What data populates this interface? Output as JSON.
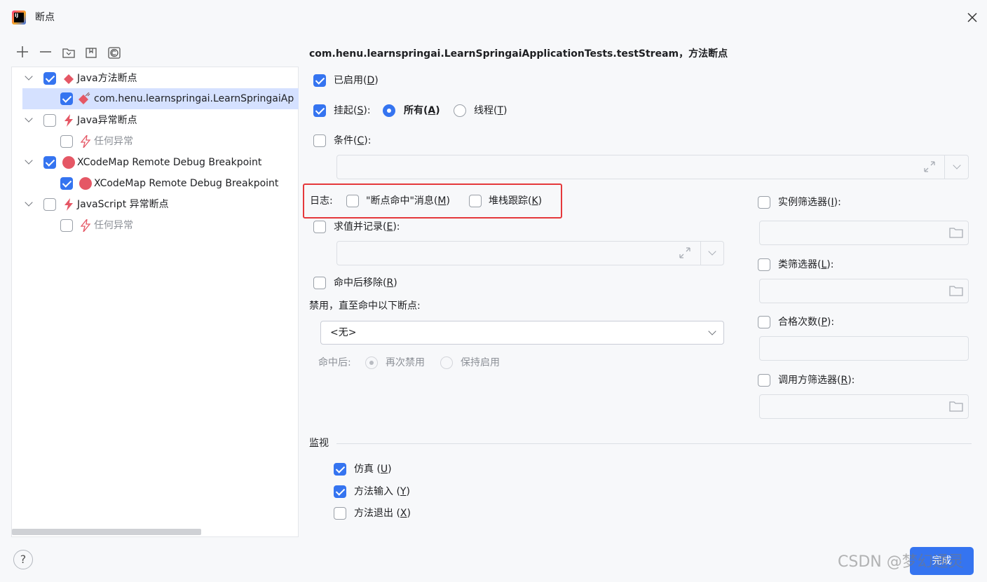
{
  "window": {
    "title": "断点",
    "logo_text": "IJ"
  },
  "toolbar": {
    "add": "+",
    "remove": "—"
  },
  "tree": {
    "items": [
      {
        "label": "Java方法断点",
        "checked": true,
        "icon": "diamond-icon"
      },
      {
        "label": "com.henu.learnspringai.LearnSpringaiAp",
        "checked": true,
        "icon": "method-breakpoint-icon"
      },
      {
        "label": "Java异常断点",
        "checked": false,
        "icon": "lightning-icon"
      },
      {
        "label": "任何异常",
        "checked": false,
        "icon": "lightning-icon"
      },
      {
        "label": "XCodeMap Remote Debug Breakpoint",
        "checked": true,
        "icon": "red-dot-icon"
      },
      {
        "label": "XCodeMap Remote Debug Breakpoint",
        "checked": true,
        "icon": "red-dot-icon"
      },
      {
        "label": "JavaScript 异常断点",
        "checked": false,
        "icon": "lightning-icon"
      },
      {
        "label": "任何异常",
        "checked": false,
        "icon": "lightning-icon"
      }
    ]
  },
  "details": {
    "title": "com.henu.learnspringai.LearnSpringaiApplicationTests.testStream，方法断点",
    "enabled": {
      "text": "已启用(",
      "key": "D",
      "end": ")"
    },
    "suspend": {
      "text": "挂起(",
      "key": "S",
      "end": "):"
    },
    "all": {
      "text": "所有(",
      "key": "A",
      "end": ")"
    },
    "thread": {
      "text": "线程(",
      "key": "T",
      "end": ")"
    },
    "condition": {
      "text": "条件(",
      "key": "C",
      "end": "):"
    },
    "log_label": "日志:",
    "log_message": {
      "text": "\"断点命中\"消息(",
      "key": "M",
      "end": ")"
    },
    "stack_trace": {
      "text": "堆栈跟踪(",
      "key": "K",
      "end": ")"
    },
    "evaluate_log": {
      "text": "求值并记录(",
      "key": "E",
      "end": "):"
    },
    "remove_once_hit": {
      "text": "命中后移除(",
      "key": "R",
      "end": ")"
    },
    "disable_until": "禁用，直至命中以下断点:",
    "disable_until_value": "<无>",
    "after_hit": "命中后:",
    "disable_again": "再次禁用",
    "keep_enabled": "保持启用"
  },
  "filters": {
    "instance": {
      "text": "实例筛选器(",
      "key": "I",
      "end": "):"
    },
    "class": {
      "text": "类筛选器(",
      "key": "L",
      "end": "):"
    },
    "pass_count": {
      "text": "合格次数(",
      "key": "P",
      "end": "):"
    },
    "caller": {
      "text": "调用方筛选器(",
      "key": "R",
      "end": "):"
    }
  },
  "monitor": {
    "header": "监视",
    "emulate": {
      "text": "仿真 (",
      "key": "U",
      "end": ")"
    },
    "method_entry": {
      "text": "方法输入 (",
      "key": "Y",
      "end": ")"
    },
    "method_exit": {
      "text": "方法退出 (",
      "key": "X",
      "end": ")"
    }
  },
  "footer": {
    "help": "?",
    "done": "完成"
  },
  "watermark": "CSDN @梦幻通灵",
  "colors": {
    "accent": "#3574f0",
    "highlight_border": "#e5383b",
    "breakpoint_red": "#e55765"
  }
}
